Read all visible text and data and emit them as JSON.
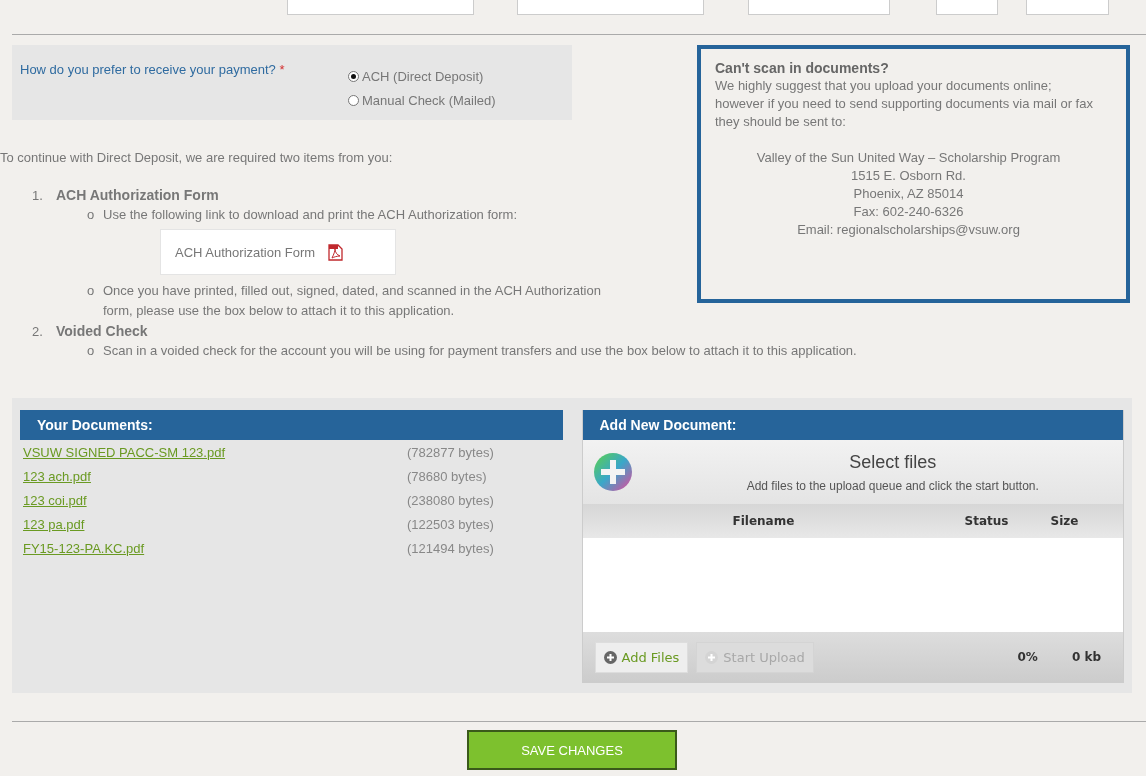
{
  "payment": {
    "question": "How do you prefer to receive your payment?",
    "required_mark": "*",
    "options": [
      {
        "label": "ACH (Direct Deposit)",
        "selected": true
      },
      {
        "label": "Manual Check (Mailed)",
        "selected": false
      }
    ]
  },
  "info": {
    "title": "Can't scan in documents?",
    "body": "We highly suggest that you upload your documents online; however if you need to send supporting documents via mail or fax they should be sent to:",
    "address_lines": [
      "Valley of the Sun United Way – Scholarship Program",
      "1515 E. Osborn Rd.",
      "Phoenix, AZ 85014",
      "Fax: 602-240-6326",
      "Email: regionalscholarships@vsuw.org"
    ]
  },
  "instructions": {
    "intro": "To continue with Direct Deposit, we are required two items from you:",
    "steps": [
      {
        "number": "1.",
        "title": "ACH Authorization Form",
        "items": [
          {
            "kind": "bullet",
            "bullet": "o",
            "text": "Use the following link to download and print the ACH Authorization form:"
          },
          {
            "kind": "link",
            "text": "ACH Authorization Form"
          },
          {
            "kind": "bullet",
            "bullet": "o",
            "text": "Once you have printed, filled out, signed, dated, and scanned in the ACH Authorization form, please use the box below to attach it to this application."
          }
        ]
      },
      {
        "number": "2.",
        "title": "Voided Check",
        "items": [
          {
            "kind": "bullet",
            "bullet": "o",
            "text": "Scan in a voided check for the account you will be using for payment transfers and use the box below to attach it to this application."
          }
        ]
      }
    ]
  },
  "documents": {
    "title": "Your Documents:",
    "files": [
      {
        "name": "VSUW SIGNED PACC-SM 123.pdf",
        "size": "(782877 bytes)"
      },
      {
        "name": "123 ach.pdf",
        "size": "(78680 bytes)"
      },
      {
        "name": "123 coi.pdf",
        "size": "(238080 bytes)"
      },
      {
        "name": "123 pa.pdf",
        "size": "(122503 bytes)"
      },
      {
        "name": "FY15-123-PA.KC.pdf",
        "size": "(121494 bytes)"
      }
    ]
  },
  "uploader": {
    "title": "Add New Document:",
    "select_title": "Select files",
    "select_hint": "Add files to the upload queue and click the start button.",
    "columns": [
      "Filename",
      "Status",
      "Size"
    ],
    "buttons": [
      {
        "label": "Add Files",
        "disabled": false
      },
      {
        "label": "Start Upload",
        "disabled": true
      }
    ],
    "percent": "0%",
    "total": "0 kb"
  },
  "save_button": "SAVE CHANGES"
}
